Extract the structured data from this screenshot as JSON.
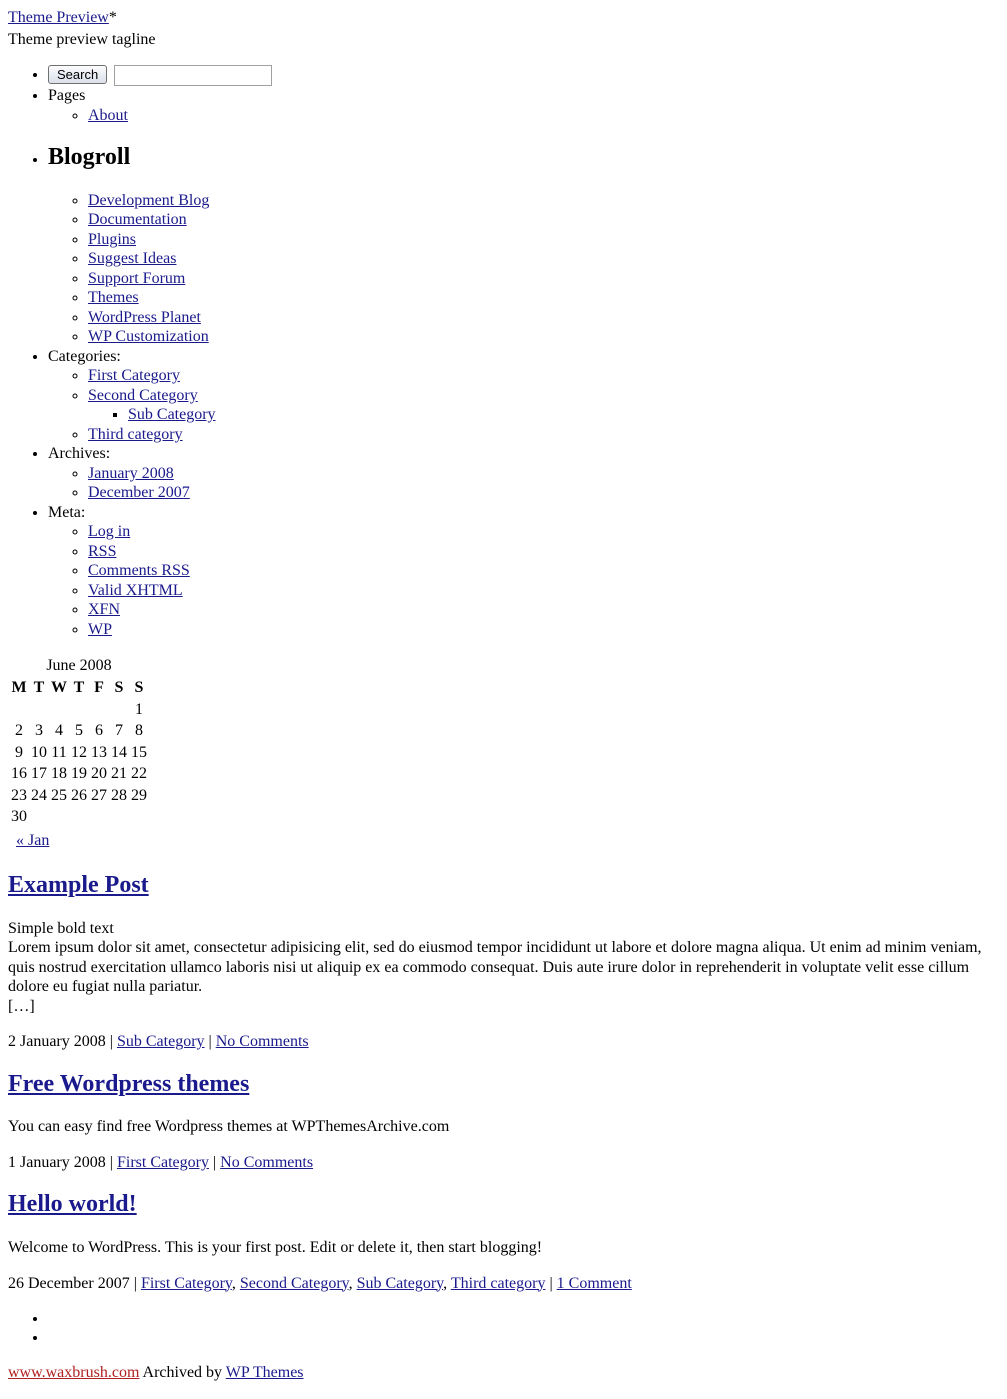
{
  "site": {
    "title": "Theme Preview",
    "title_suffix": "*",
    "tagline": "Theme preview tagline"
  },
  "search": {
    "button_label": "Search",
    "value": "",
    "placeholder": ""
  },
  "sidebar": {
    "pages": {
      "label": "Pages",
      "items": [
        {
          "label": "About"
        }
      ]
    },
    "blogroll": {
      "heading": "Blogroll",
      "items": [
        {
          "label": "Development Blog"
        },
        {
          "label": "Documentation"
        },
        {
          "label": "Plugins"
        },
        {
          "label": "Suggest Ideas"
        },
        {
          "label": "Support Forum"
        },
        {
          "label": "Themes"
        },
        {
          "label": "WordPress Planet"
        },
        {
          "label": "WP Customization"
        }
      ]
    },
    "categories": {
      "label": "Categories:",
      "items": [
        {
          "label": "First Category"
        },
        {
          "label": "Second Category",
          "children": [
            {
              "label": "Sub Category"
            }
          ]
        },
        {
          "label": "Third category"
        }
      ]
    },
    "archives": {
      "label": "Archives:",
      "items": [
        {
          "label": "January 2008"
        },
        {
          "label": "December 2007"
        }
      ]
    },
    "meta": {
      "label": "Meta:",
      "items": [
        {
          "label": "Log in"
        },
        {
          "label": "RSS"
        },
        {
          "label": "Comments RSS"
        },
        {
          "label": "Valid XHTML"
        },
        {
          "label": "XFN"
        },
        {
          "label": "WP"
        }
      ]
    }
  },
  "calendar": {
    "caption": "June 2008",
    "weekdays": [
      "M",
      "T",
      "W",
      "T",
      "F",
      "S",
      "S"
    ],
    "weeks": [
      [
        "",
        "",
        "",
        "",
        "",
        "",
        "1"
      ],
      [
        "2",
        "3",
        "4",
        "5",
        "6",
        "7",
        "8"
      ],
      [
        "9",
        "10",
        "11",
        "12",
        "13",
        "14",
        "15"
      ],
      [
        "16",
        "17",
        "18",
        "19",
        "20",
        "21",
        "22"
      ],
      [
        "23",
        "24",
        "25",
        "26",
        "27",
        "28",
        "29"
      ],
      [
        "30",
        "",
        "",
        "",
        "",
        "",
        ""
      ]
    ],
    "prev_label": "« Jan",
    "next_label": ""
  },
  "posts": [
    {
      "title": "Example Post",
      "lead": "Simple bold text",
      "body": "Lorem ipsum dolor sit amet, consectetur adipisicing elit, sed do eiusmod tempor incididunt ut labore et dolore magna aliqua. Ut enim ad minim veniam, quis nostrud exercitation ullamco laboris nisi ut aliquip ex ea commodo consequat. Duis aute irure dolor in reprehenderit in voluptate velit esse cillum dolore eu fugiat nulla pariatur.",
      "more": "[…]",
      "date": "2 January 2008",
      "sep1": "|",
      "categories": "Sub Category",
      "sep2": "|",
      "comments": "No Comments"
    },
    {
      "title": "Free Wordpress themes",
      "lead": "",
      "body": "You can easy find free Wordpress themes at WPThemesArchive.com",
      "more": "",
      "date": "1 January 2008",
      "sep1": "|",
      "categories": "First Category",
      "sep2": "|",
      "comments": "No Comments"
    },
    {
      "title": "Hello world!",
      "lead": "",
      "body": "Welcome to WordPress. This is your first post. Edit or delete it, then start blogging!",
      "more": "",
      "date": "26 December 2007",
      "sep1": "|",
      "categories": "First Category, Second Category, Sub Category, Third category",
      "sep2": "|",
      "comments": "1 Comment"
    }
  ],
  "post3_categories": [
    {
      "label": "First Category",
      "after": ", "
    },
    {
      "label": "Second Category",
      "after": ", "
    },
    {
      "label": "Sub Category",
      "after": ", "
    },
    {
      "label": "Third category",
      "after": ""
    }
  ],
  "footer": {
    "nav_items": [
      "",
      ""
    ],
    "site_link": "www.waxbrush.com",
    "credit_text": "Archived by",
    "credit_link": "WP Themes"
  },
  "colors": {
    "link": "#1a1a8c",
    "red_link": "#b02020",
    "text": "#000000",
    "background": "#ffffff"
  }
}
